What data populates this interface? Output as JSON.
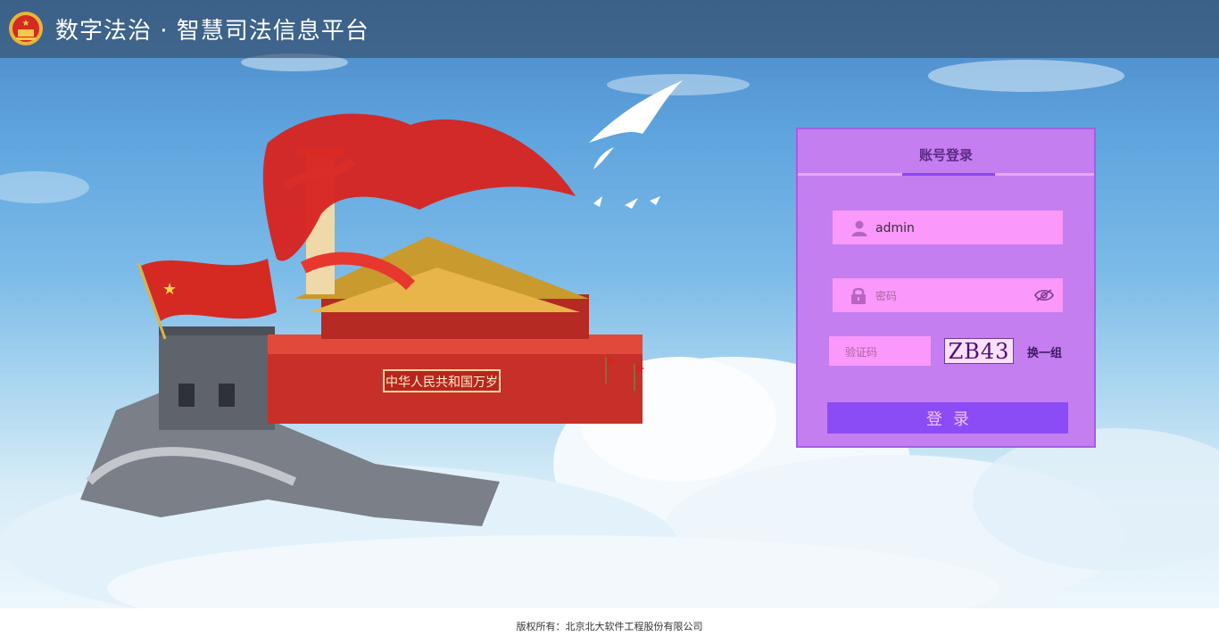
{
  "header": {
    "title": "数字法治 · 智慧司法信息平台",
    "emblem_icon": "national-emblem-icon"
  },
  "login": {
    "tab_label": "账号登录",
    "username_value": "admin",
    "password_placeholder": "密码",
    "captcha_placeholder": "验证码",
    "captcha_text": "ZB43",
    "refresh_label": "换一组",
    "submit_label": "登录",
    "icons": {
      "username": "user-icon",
      "password": "lock-icon",
      "visibility": "eye-icon"
    }
  },
  "colors": {
    "panel": "#c47ef0",
    "field": "#fa98fb",
    "button": "#8b4cf6",
    "header": "#344a64"
  },
  "footer": {
    "copyright": "版权所有：北京北大软件工程股份有限公司"
  }
}
